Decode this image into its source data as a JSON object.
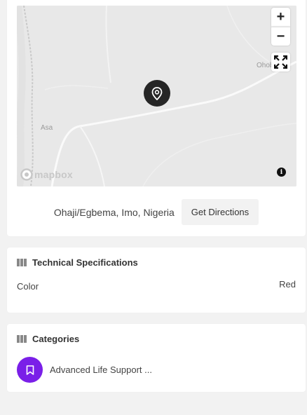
{
  "map": {
    "zoom_in_label": "+",
    "zoom_out_label": "−",
    "places": [
      "Ohoba",
      "Asa"
    ],
    "attribution_logo": "mapbox",
    "info_label": "i"
  },
  "location": {
    "text": "Ohaji/Egbema, Imo, Nigeria",
    "directions_label": "Get Directions"
  },
  "specs": {
    "title": "Technical Specifications",
    "rows": [
      {
        "label": "Color",
        "value": "Red"
      }
    ]
  },
  "categories": {
    "title": "Categories",
    "items": [
      {
        "label": "Advanced Life Support ..."
      }
    ],
    "accent": "#7a1fe8"
  }
}
